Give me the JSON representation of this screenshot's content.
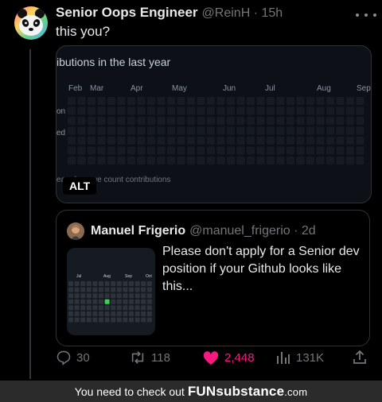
{
  "post": {
    "display_name": "Senior Oops Engineer",
    "handle_time": "@ReinH · 15h",
    "text": "this you?",
    "media": {
      "contrib_title": "ibutions in the last year",
      "months": [
        "Feb",
        "Mar",
        "Apr",
        "May",
        "Jun",
        "Jul",
        "Aug",
        "Sep"
      ],
      "day_labels": [
        "on",
        "ed"
      ],
      "footer_note": "earn how we count contributions",
      "alt_label": "ALT"
    }
  },
  "quote": {
    "display_name": "Manuel Frigerio",
    "handle_time": "@manuel_frigerio · 2d",
    "text": "Please don't apply for a Senior dev position if your Github looks like this...",
    "months": [
      "Jul",
      "Aug",
      "Sep",
      "Oct"
    ]
  },
  "actions": {
    "replies": "30",
    "reposts": "118",
    "likes": "2,448",
    "views": "131K"
  },
  "banner": {
    "prefix": "You need to check out",
    "logo_bold": "FUNsubstance",
    "logo_suffix": ".com"
  },
  "colors": {
    "like": "#f91880",
    "contrib_cell": "#161b22",
    "contrib_green": "#39d353"
  }
}
